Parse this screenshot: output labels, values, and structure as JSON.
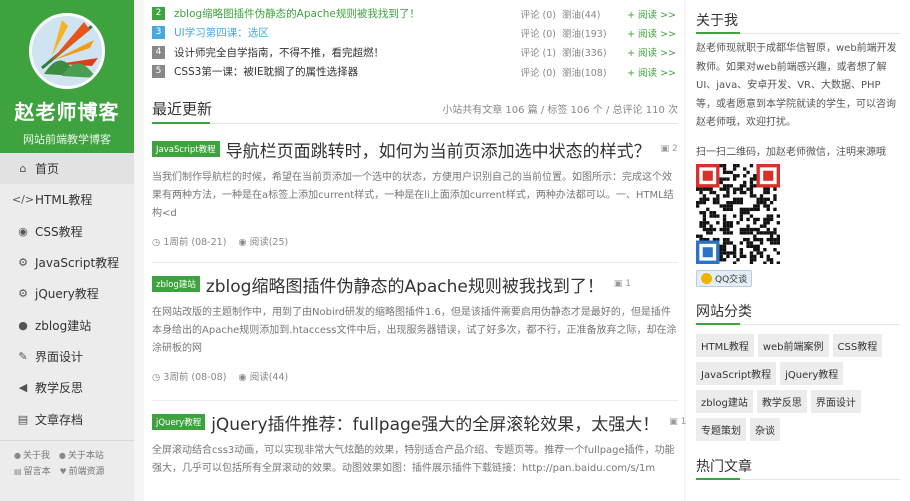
{
  "brand": {
    "title": "赵老师博客",
    "subtitle": "网站前端教学博客"
  },
  "nav": [
    {
      "icon": "home-icon",
      "glyph": "⌂",
      "label": "首页"
    },
    {
      "icon": "code-icon",
      "glyph": "</>",
      "label": "HTML教程"
    },
    {
      "icon": "eye-icon",
      "glyph": "◉",
      "label": "CSS教程"
    },
    {
      "icon": "gear-icon",
      "glyph": "⚙",
      "label": "JavaScript教程"
    },
    {
      "icon": "gears-icon",
      "glyph": "⚙",
      "label": "jQuery教程"
    },
    {
      "icon": "globe-icon",
      "glyph": "●",
      "label": "zblog建站"
    },
    {
      "icon": "magic-wand-icon",
      "glyph": "✎",
      "label": "界面设计"
    },
    {
      "icon": "bullhorn-icon",
      "glyph": "◀",
      "label": "教学反思"
    },
    {
      "icon": "archive-icon",
      "glyph": "▤",
      "label": "文章存档"
    }
  ],
  "side_footer": {
    "about_me": "关于我",
    "about_site": "关于本站",
    "guestbook": "留言本",
    "resources": "前端资源"
  },
  "hot_list": [
    {
      "num": "2",
      "color": "#3ea33e",
      "title": "zblog缩略图插件伪静态的Apache规则被我找到了！",
      "title_color": "#3ea33e",
      "comments": "评论 (0)",
      "views": "瀏油(44)",
      "more": "+ 阅读 >>"
    },
    {
      "num": "3",
      "color": "#4aa8e0",
      "title": "UI学习第四课：选区",
      "title_color": "#4aa8e0",
      "comments": "评论 (0)",
      "views": "瀏油(193)",
      "more": "+ 阅读 >>"
    },
    {
      "num": "4",
      "color": "#888888",
      "title": "设计师完全自学指南，不得不推，看完超燃！",
      "title_color": "#333333",
      "comments": "评论 (1)",
      "views": "瀏油(336)",
      "more": "+ 阅读 >>"
    },
    {
      "num": "5",
      "color": "#888888",
      "title": "CSS3第一课：被IE耽搁了的属性选择器",
      "title_color": "#333333",
      "comments": "评论 (0)",
      "views": "瀏油(108)",
      "more": "+ 阅读 >>"
    }
  ],
  "recent": {
    "title": "最近更新",
    "stats": "小站共有文章 106 篇 / 标签 106 个 / 总评论 110 次"
  },
  "posts": [
    {
      "tag": "JavaScript教程",
      "title": "导航栏页面跳转时，如何为当前页添加选中状态的样式？",
      "imgs": "2",
      "excerpt": "当我们制作导航栏的时候，希望在当前页添加一个选中的状态，方便用户识别自己的当前位置。如图所示：完成这个效果有两种方法，一种是在a标签上添加current样式，一种是在li上面添加current样式，两种办法都可以。一、HTML结构<d",
      "time": "1周前 (08-21)",
      "views": "阅读(25)"
    },
    {
      "tag": "zblog建站",
      "title": "zblog缩略图插件伪静态的Apache规则被我找到了！",
      "imgs": "1",
      "excerpt": "在网站改版的主题制作中，用到了由Nobird研发的缩略图插件1.6，但是该插件需要启用伪静态才是最好的，但是插件本身给出的Apache规则添加到.htaccess文件中后，出现服务器错误，试了好多次，都不行，正准备放弃之际，却在涂涂研板的网",
      "time": "3周前 (08-08)",
      "views": "阅读(44)"
    },
    {
      "tag": "jQuery教程",
      "title": "jQuery插件推荐：fullpage强大的全屏滚轮效果，太强大！",
      "imgs": "1",
      "excerpt": "全屏滚动结合css3动画，可以实现非常大气炫酷的效果，特别适合产品介绍、专题页等。推荐一个fullpage插件，功能强大，几乎可以包括所有全屏滚动的效果。动图效果如图：插件展示插件下载链接：http://pan.baidu.com/s/1m",
      "time": "1个月前 (07-27)",
      "views": "阅读(59)"
    }
  ],
  "about": {
    "title": "关于我",
    "text": "赵老师现就职于成都华信智原，web前端开发教师。如果对web前端感兴趣，或者想了解UI、java、安卓开发、VR、大数据、PHP等，或者愿意到本学院就读的学生，可以咨询赵老师哦，欢迎打扰。",
    "qr_caption": "扫一扫二维码，加赵老师微信，注明来源哦",
    "qq_button": "QQ交谈"
  },
  "categories_title": "网站分类",
  "categories": [
    "HTML教程",
    "web前端案例",
    "CSS教程",
    "JavaScript教程",
    "jQuery教程",
    "zblog建站",
    "教学反思",
    "界面设计",
    "专题策划",
    "杂谈"
  ],
  "hot_title": "热门文章",
  "colors": {
    "accent": "#3ea33e",
    "blue": "#4aa8e0"
  }
}
